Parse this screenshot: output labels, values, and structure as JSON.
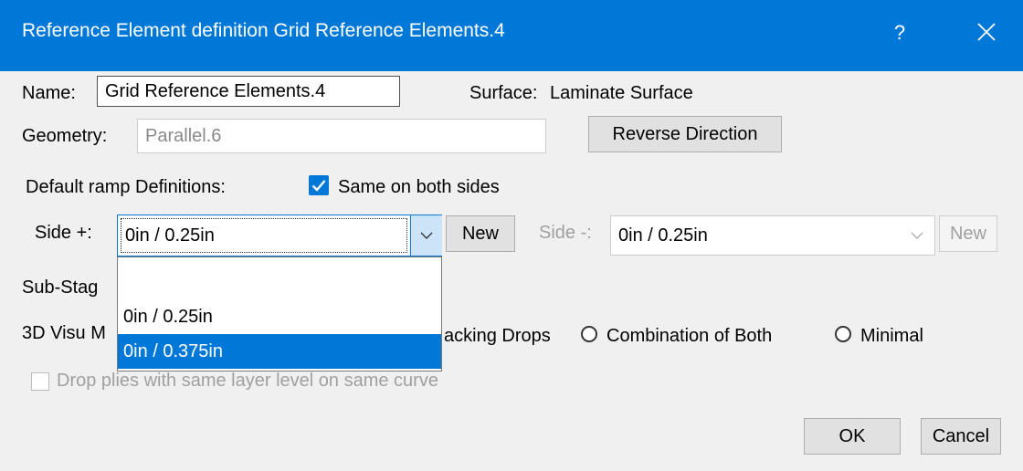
{
  "dialog": {
    "title": "Reference Element definition Grid Reference Elements.4",
    "help_glyph": "?",
    "close_icon": "close-icon"
  },
  "name": {
    "label": "Name:",
    "value": "Grid Reference Elements.4"
  },
  "surface": {
    "label": "Surface:",
    "value": "Laminate Surface"
  },
  "geometry": {
    "label": "Geometry:",
    "value": "Parallel.6"
  },
  "reverse_button": "Reverse Direction",
  "default_ramp": {
    "label": "Default ramp Definitions:"
  },
  "same_both_sides": {
    "label": "Same on both sides",
    "checked": true
  },
  "side_plus": {
    "label": "Side +:",
    "value": "0in / 0.25in",
    "new_label": "New",
    "options": [
      "",
      "0in / 0.25in",
      "0in / 0.375in"
    ],
    "highlighted": "0in / 0.375in"
  },
  "side_minus": {
    "label": "Side -:",
    "value": "0in / 0.25in",
    "new_label": "New"
  },
  "sub_stage": {
    "label_visible": "Sub-Stag"
  },
  "visu": {
    "label_visible": "3D Visu M",
    "options": [
      {
        "label_visible": "acking Drops"
      },
      {
        "label": "Combination of Both"
      },
      {
        "label": "Minimal"
      }
    ]
  },
  "drop_plies": {
    "label": "Drop plies with same layer level on same curve",
    "checked": false
  },
  "ok_button": "OK",
  "cancel_button": "Cancel",
  "colors": {
    "accent": "#0078d7",
    "dialog_bg": "#f0f0f0",
    "disabled_text": "#a0a0a0"
  }
}
